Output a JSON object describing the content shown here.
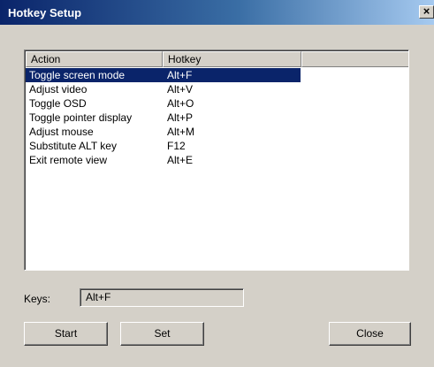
{
  "window": {
    "title": "Hotkey Setup",
    "close_glyph": "×"
  },
  "list": {
    "columns": [
      "Action",
      "Hotkey"
    ],
    "selected_index": 0,
    "rows": [
      {
        "action": "Toggle screen mode",
        "hotkey": "Alt+F"
      },
      {
        "action": "Adjust video",
        "hotkey": "Alt+V"
      },
      {
        "action": "Toggle OSD",
        "hotkey": "Alt+O"
      },
      {
        "action": "Toggle pointer display",
        "hotkey": "Alt+P"
      },
      {
        "action": "Adjust mouse",
        "hotkey": "Alt+M"
      },
      {
        "action": "Substitute ALT key",
        "hotkey": "F12"
      },
      {
        "action": "Exit remote view",
        "hotkey": "Alt+E"
      }
    ]
  },
  "keys": {
    "label": "Keys:",
    "value": "Alt+F"
  },
  "buttons": {
    "start": "Start",
    "set": "Set",
    "close": "Close"
  },
  "colors": {
    "selection": "#0a246a",
    "face": "#d4d0c8"
  }
}
